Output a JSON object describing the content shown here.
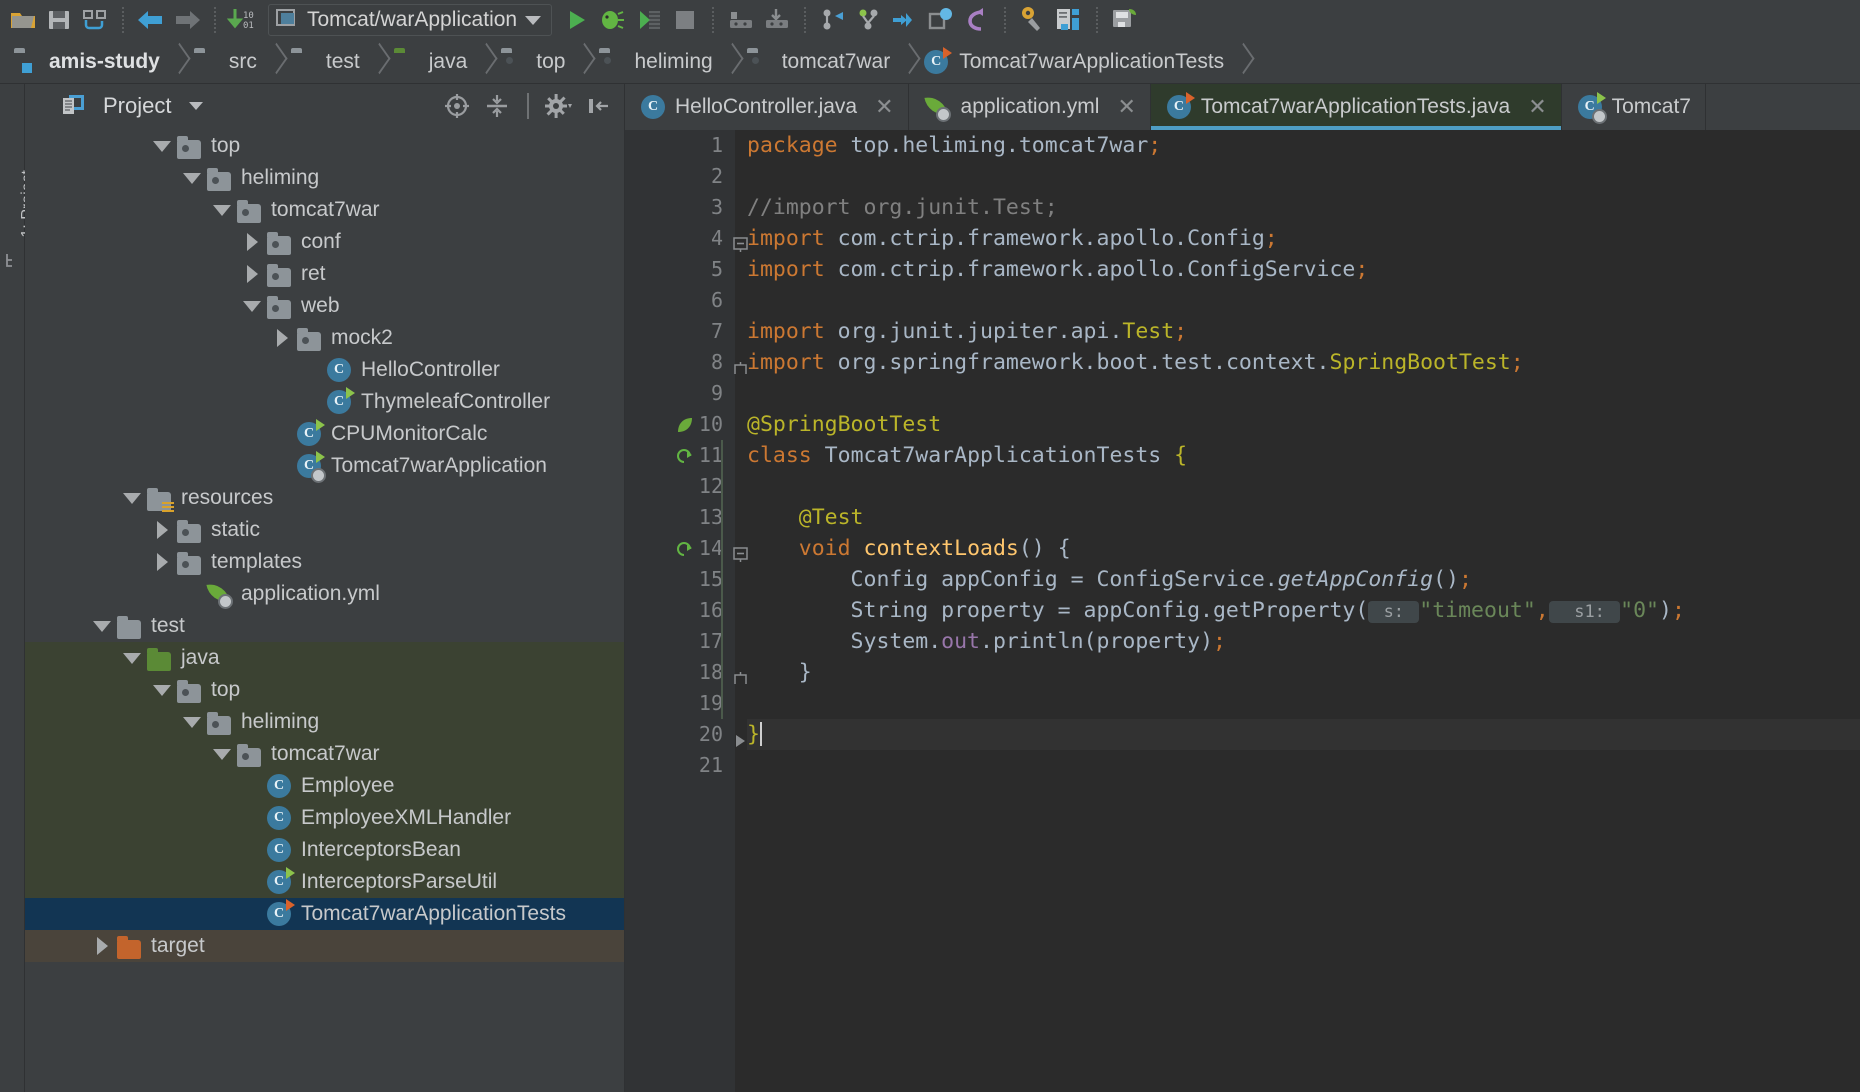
{
  "toolbar": {
    "icons": [
      {
        "name": "open-folder-icon"
      },
      {
        "name": "save-all-icon"
      },
      {
        "name": "sync-refresh-icon"
      },
      {
        "name": "back-arrow-icon"
      },
      {
        "name": "forward-arrow-icon"
      },
      {
        "name": "update-project-icon"
      }
    ],
    "run_config": {
      "label": "Tomcat/warApplication",
      "dropdown": "▼"
    },
    "right_icons": [
      {
        "name": "run-icon"
      },
      {
        "name": "debug-icon"
      },
      {
        "name": "run-with-coverage-icon"
      },
      {
        "name": "stop-icon"
      },
      {
        "name": "build-project-icon"
      },
      {
        "name": "download-artifact-icon"
      },
      {
        "name": "vcs-update-icon"
      },
      {
        "name": "vcs-commit-icon"
      },
      {
        "name": "vcs-push-icon"
      },
      {
        "name": "search-everywhere-icon"
      },
      {
        "name": "undo-icon"
      },
      {
        "name": "settings-icon"
      },
      {
        "name": "project-structure-icon"
      },
      {
        "name": "save-spring-icon"
      }
    ]
  },
  "breadcrumbs": [
    {
      "label": "amis-study",
      "icon": "module-icon"
    },
    {
      "label": "src",
      "icon": "folder-icon"
    },
    {
      "label": "test",
      "icon": "folder-icon"
    },
    {
      "label": "java",
      "icon": "source-root-folder-icon"
    },
    {
      "label": "top",
      "icon": "package-icon"
    },
    {
      "label": "heliming",
      "icon": "package-icon"
    },
    {
      "label": "tomcat7war",
      "icon": "package-icon"
    },
    {
      "label": "Tomcat7warApplicationTests",
      "icon": "java-test-class-icon"
    }
  ],
  "sidebar_stripe": {
    "label": "1: Project"
  },
  "project_panel": {
    "title": "Project",
    "dropdown": "▼",
    "actions": [
      {
        "name": "locate-file-icon"
      },
      {
        "name": "collapse-all-icon"
      },
      {
        "name": "settings-gear-icon"
      },
      {
        "name": "hide-panel-icon"
      }
    ],
    "tree": [
      {
        "label": "top",
        "indent": 4,
        "twisty": "down",
        "icon": "package",
        "state": "clipped"
      },
      {
        "label": "heliming",
        "indent": 5,
        "twisty": "down",
        "icon": "package"
      },
      {
        "label": "tomcat7war",
        "indent": 6,
        "twisty": "down",
        "icon": "package"
      },
      {
        "label": "conf",
        "indent": 7,
        "twisty": "right",
        "icon": "package"
      },
      {
        "label": "ret",
        "indent": 7,
        "twisty": "right",
        "icon": "package"
      },
      {
        "label": "web",
        "indent": 7,
        "twisty": "down",
        "icon": "package"
      },
      {
        "label": "mock2",
        "indent": 8,
        "twisty": "right",
        "icon": "package"
      },
      {
        "label": "HelloController",
        "indent": 9,
        "twisty": "none",
        "icon": "class"
      },
      {
        "label": "ThymeleafController",
        "indent": 9,
        "twisty": "none",
        "icon": "class-run"
      },
      {
        "label": "CPUMonitorCalc",
        "indent": 8,
        "twisty": "none",
        "icon": "class-run"
      },
      {
        "label": "Tomcat7warApplication",
        "indent": 8,
        "twisty": "none",
        "icon": "class-spring-boot"
      },
      {
        "label": "resources",
        "indent": 3,
        "twisty": "down",
        "icon": "resources-folder"
      },
      {
        "label": "static",
        "indent": 4,
        "twisty": "right",
        "icon": "package"
      },
      {
        "label": "templates",
        "indent": 4,
        "twisty": "right",
        "icon": "package"
      },
      {
        "label": "application.yml",
        "indent": 5,
        "twisty": "none",
        "icon": "spring-yml"
      },
      {
        "label": "test",
        "indent": 2,
        "twisty": "down",
        "icon": "folder"
      },
      {
        "label": "java",
        "indent": 3,
        "twisty": "down",
        "icon": "folder-green",
        "bg": "green"
      },
      {
        "label": "top",
        "indent": 4,
        "twisty": "down",
        "icon": "package",
        "bg": "green"
      },
      {
        "label": "heliming",
        "indent": 5,
        "twisty": "down",
        "icon": "package",
        "bg": "green"
      },
      {
        "label": "tomcat7war",
        "indent": 6,
        "twisty": "down",
        "icon": "package",
        "bg": "green"
      },
      {
        "label": "Employee",
        "indent": 7,
        "twisty": "none",
        "icon": "class",
        "bg": "green"
      },
      {
        "label": "EmployeeXMLHandler",
        "indent": 7,
        "twisty": "none",
        "icon": "class",
        "bg": "green"
      },
      {
        "label": "InterceptorsBean",
        "indent": 7,
        "twisty": "none",
        "icon": "class",
        "bg": "green"
      },
      {
        "label": "InterceptorsParseUtil",
        "indent": 7,
        "twisty": "none",
        "icon": "class-run",
        "bg": "green"
      },
      {
        "label": "Tomcat7warApplicationTests",
        "indent": 7,
        "twisty": "none",
        "icon": "class-test",
        "bg": "selected"
      },
      {
        "label": "target",
        "indent": 2,
        "twisty": "right",
        "icon": "folder-orange",
        "bg": "brown"
      }
    ]
  },
  "editor": {
    "tabs": [
      {
        "label": "HelloController.java",
        "icon": "java-class-icon",
        "active": false,
        "close": "✕"
      },
      {
        "label": "application.yml",
        "icon": "spring-yml-icon",
        "active": false,
        "close": "✕"
      },
      {
        "label": "Tomcat7warApplicationTests.java",
        "icon": "java-test-class-icon",
        "active": true,
        "close": "✕"
      },
      {
        "label": "Tomcat7",
        "icon": "spring-boot-class-icon",
        "active": false,
        "close": ""
      }
    ],
    "line_numbers": [
      "1",
      "2",
      "3",
      "4",
      "5",
      "6",
      "7",
      "8",
      "9",
      "10",
      "11",
      "12",
      "13",
      "14",
      "15",
      "16",
      "17",
      "18",
      "19",
      "20",
      "21"
    ],
    "current_line": 20,
    "code_lines": [
      {
        "n": 1,
        "tokens": [
          {
            "t": "package",
            "c": "kw"
          },
          {
            "t": " top.heliming.tomcat7war",
            "c": "cn"
          },
          {
            "t": ";",
            "c": "sem"
          }
        ]
      },
      {
        "n": 2,
        "tokens": []
      },
      {
        "n": 3,
        "tokens": [
          {
            "t": "//import org.junit.Test;",
            "c": "cm"
          }
        ]
      },
      {
        "n": 4,
        "tokens": [
          {
            "t": "import",
            "c": "kw"
          },
          {
            "t": " com.ctrip.framework.apollo.Config",
            "c": "cn"
          },
          {
            "t": ";",
            "c": "sem"
          }
        ],
        "gutter_fold": "minus"
      },
      {
        "n": 5,
        "tokens": [
          {
            "t": "import",
            "c": "kw"
          },
          {
            "t": " com.ctrip.framework.apollo.ConfigService",
            "c": "cn"
          },
          {
            "t": ";",
            "c": "sem"
          }
        ]
      },
      {
        "n": 6,
        "tokens": []
      },
      {
        "n": 7,
        "tokens": [
          {
            "t": "import",
            "c": "kw"
          },
          {
            "t": " org.junit.jupiter.api.",
            "c": "cn"
          },
          {
            "t": "Test",
            "c": "ann"
          },
          {
            "t": ";",
            "c": "sem"
          }
        ]
      },
      {
        "n": 8,
        "tokens": [
          {
            "t": "import",
            "c": "kw"
          },
          {
            "t": " org.springframework.boot.test.context.",
            "c": "cn"
          },
          {
            "t": "SpringBootTest",
            "c": "ann"
          },
          {
            "t": ";",
            "c": "sem"
          }
        ],
        "gutter_fold": "end"
      },
      {
        "n": 9,
        "tokens": []
      },
      {
        "n": 10,
        "tokens": [
          {
            "t": "@SpringBootTest",
            "c": "ann"
          }
        ],
        "gutter_icon": "spring-leaf"
      },
      {
        "n": 11,
        "tokens": [
          {
            "t": "class",
            "c": "kw"
          },
          {
            "t": " Tomcat7warApplicationTests ",
            "c": "cn"
          },
          {
            "t": "{",
            "c": "ann"
          }
        ],
        "gutter_icon": "run-test"
      },
      {
        "n": 12,
        "tokens": []
      },
      {
        "n": 13,
        "tokens": [
          {
            "t": "    @Test",
            "c": "ann"
          }
        ]
      },
      {
        "n": 14,
        "tokens": [
          {
            "t": "    ",
            "c": "cn"
          },
          {
            "t": "void",
            "c": "kw"
          },
          {
            "t": " ",
            "c": "cn"
          },
          {
            "t": "contextLoads",
            "c": "mth"
          },
          {
            "t": "() {",
            "c": "cn"
          }
        ],
        "gutter_icon": "run-test",
        "gutter_fold": "minus"
      },
      {
        "n": 15,
        "tokens": [
          {
            "t": "        Config appConfig = ConfigService.",
            "c": "cn"
          },
          {
            "t": "getAppConfig",
            "c": "it"
          },
          {
            "t": "()",
            "c": "cn"
          },
          {
            "t": ";",
            "c": "sem"
          }
        ]
      },
      {
        "n": 16,
        "tokens": [
          {
            "t": "        String property = appConfig.getProperty(",
            "c": "cn"
          },
          {
            "t": " s: ",
            "c": "hint"
          },
          {
            "t": "\"timeout\"",
            "c": "st"
          },
          {
            "t": ",",
            "c": "sem"
          },
          {
            "t": "  s1: ",
            "c": "hint"
          },
          {
            "t": "\"0\"",
            "c": "st"
          },
          {
            "t": ")",
            "c": "cn"
          },
          {
            "t": ";",
            "c": "sem"
          }
        ]
      },
      {
        "n": 17,
        "tokens": [
          {
            "t": "        System.",
            "c": "cn"
          },
          {
            "t": "out",
            "c": "pur"
          },
          {
            "t": ".println(property)",
            "c": "cn"
          },
          {
            "t": ";",
            "c": "sem"
          }
        ]
      },
      {
        "n": 18,
        "tokens": [
          {
            "t": "    }",
            "c": "cn"
          }
        ],
        "gutter_fold": "end"
      },
      {
        "n": 19,
        "tokens": []
      },
      {
        "n": 20,
        "tokens": [
          {
            "t": "}",
            "c": "ann"
          }
        ],
        "gutter_fold": "arrow"
      },
      {
        "n": 21,
        "tokens": []
      }
    ]
  },
  "colors": {
    "bg_panel": "#3c3f41",
    "bg_editor": "#2b2b2b",
    "accent_tab": "#4e9ec4",
    "selection": "#123553",
    "test_scope_green": "#3b4232",
    "keyword_orange": "#cc7832",
    "string_green": "#6a8759",
    "annotation_yellow": "#bbb529"
  }
}
